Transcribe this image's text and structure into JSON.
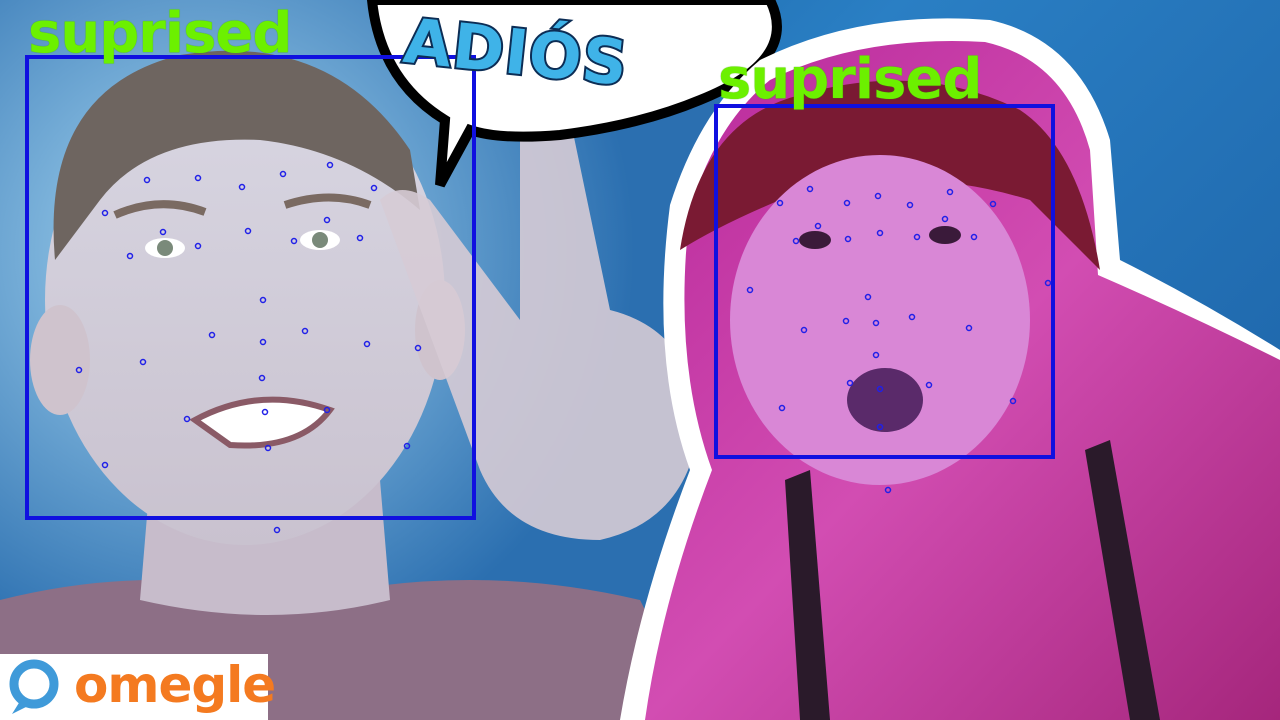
{
  "bubble": {
    "text": "ADIÓS"
  },
  "left_face": {
    "emotion_label": "suprised"
  },
  "right_face": {
    "emotion_label": "suprised"
  },
  "logo": {
    "text": "omegle",
    "icon": "omegle-chat-icon"
  },
  "colors": {
    "label_green": "#6cf000",
    "box_blue": "#1010e0",
    "logo_orange": "#f47a20",
    "logo_blue": "#3f9ad9",
    "bubble_text": "#3fb3e8"
  }
}
